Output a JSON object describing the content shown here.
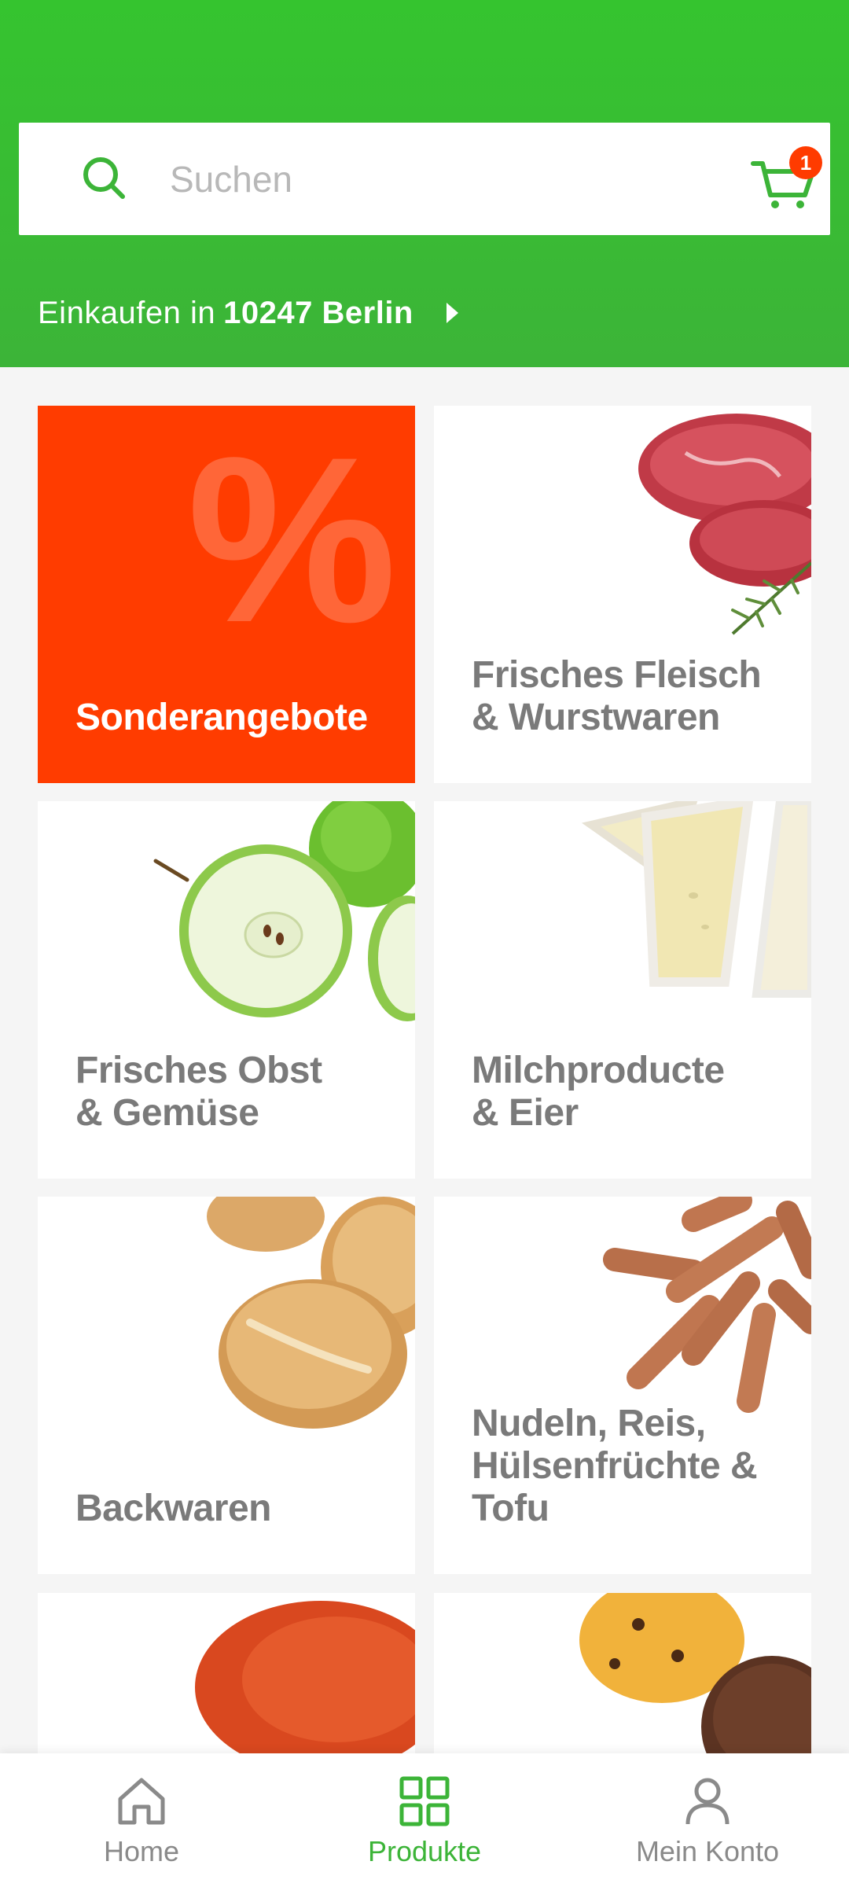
{
  "search": {
    "placeholder": "Suchen"
  },
  "cart": {
    "count": "1"
  },
  "location": {
    "prefix": "Einkaufen in",
    "place": "10247 Berlin"
  },
  "categories": [
    {
      "label": "Sonderangebote",
      "symbol": "%"
    },
    {
      "label": "Frisches Fleisch\n& Wurstwaren"
    },
    {
      "label": "Frisches Obst\n& Gemüse"
    },
    {
      "label": "Milchproducte\n& Eier"
    },
    {
      "label": "Backwaren"
    },
    {
      "label": "Nudeln, Reis,\nHülsenfrüchte &\nTofu"
    }
  ],
  "nav": {
    "items": [
      {
        "label": "Home",
        "icon": "home-icon"
      },
      {
        "label": "Produkte",
        "icon": "grid-icon",
        "active": true
      },
      {
        "label": "Mein Konto",
        "icon": "user-icon"
      }
    ]
  },
  "colors": {
    "brand_green": "#3cb438",
    "offer_red": "#ff3c00",
    "badge": "#ff3b00"
  }
}
